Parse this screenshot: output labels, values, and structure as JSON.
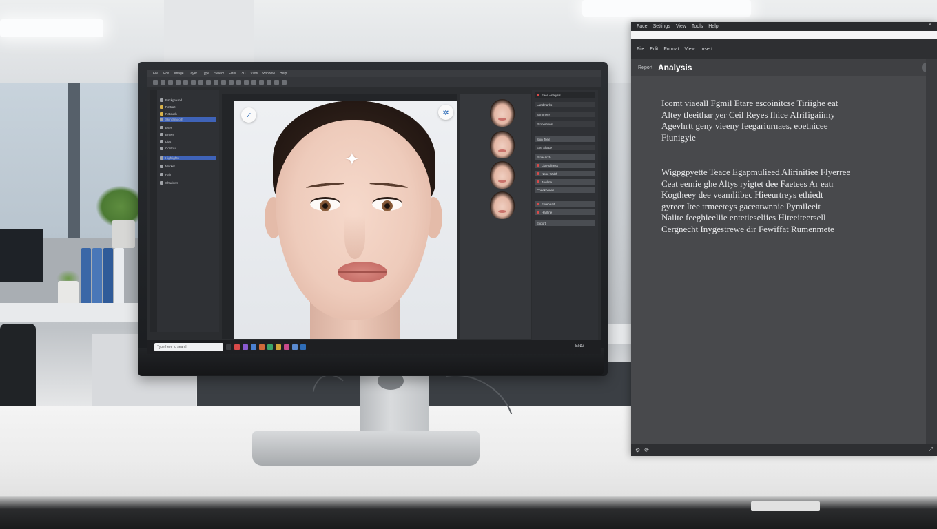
{
  "monitor": {
    "menu_items": [
      "File",
      "Edit",
      "Image",
      "Layer",
      "Type",
      "Select",
      "Filter",
      "3D",
      "View",
      "Window",
      "Help"
    ],
    "layers": [
      "Background",
      "Portrait",
      "Retouch",
      "Skin Smooth",
      "Eyes",
      "Brows",
      "Lips",
      "Contour",
      "Highlights",
      "Marker",
      "Hair",
      "Shadows"
    ],
    "selected_layer_index": 3,
    "properties": [
      "Face Analysis",
      "Landmarks",
      "Symmetry",
      "Proportions",
      "Skin Tone",
      "Eye Shape",
      "Brow Arch",
      "Lip Fullness",
      "Nose Width",
      "Jawline",
      "Cheekbones",
      "Forehead",
      "Hairline",
      "Export"
    ],
    "search_placeholder": "Type here to search",
    "tray_text": "ENG",
    "colors": {
      "accent": "#3f63b8",
      "marker": "#ffffff",
      "alert": "#d84a4a"
    }
  },
  "side_panel": {
    "titlebar_items": [
      "Face",
      "Settings",
      "View",
      "Tools",
      "Help"
    ],
    "toolbar_items": [
      "File",
      "Edit",
      "Format",
      "View",
      "Insert"
    ],
    "header_small": "Report",
    "header_title": "Analysis",
    "paragraph_1": [
      "Icomt viaeall Fgmil Etare escoinitcse Tiriighe eat",
      "Altey tleeithar yer Ceil Reyes fhice Afrifigaiimy",
      "Agevhrtt geny vieeny feegariurnaes, eoetnicee",
      "Fiunigyie"
    ],
    "paragraph_2": [
      "Wigpgpyette Teace Egapmulieed Alirinitiee Flyerree",
      "Ceat eemie ghe Altys ryigtet dee Faetees Ar eatr",
      "Kogtheey dee veamliibec Hieeurtreys ethiedt",
      "gyreer Itee trmeeteys gaceatwnnie Pymileeit",
      "Naiite feeghieeliie entetieseliies Hiteeiteersell",
      "Cergnecht Inygestrewe dir Fewiffat Rumenmete"
    ]
  }
}
